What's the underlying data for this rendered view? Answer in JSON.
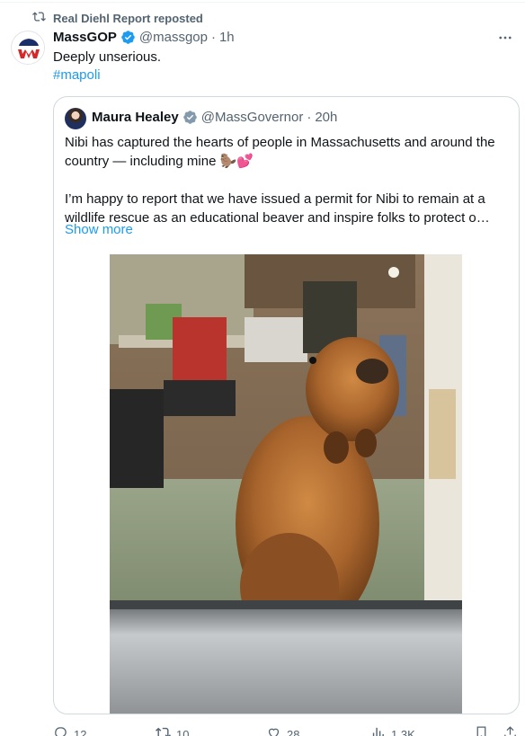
{
  "repost": {
    "label": "Real Diehl Report reposted",
    "icon": "repost-icon"
  },
  "tweet": {
    "author_name": "MassGOP",
    "author_handle": "@massgop",
    "separator": "·",
    "time": "1h",
    "text": "Deeply unserious.",
    "hashtag": "#mapoli",
    "more_icon": "more-horizontal-icon"
  },
  "quote": {
    "author_name": "Maura Healey",
    "author_handle": "@MassGovernor",
    "separator": "·",
    "time": "20h",
    "paragraph1": "Nibi has captured the hearts of people in Massachusetts and around the country — including mine 🦫💕",
    "paragraph2": "I’m happy to report that we have issued a permit for Nibi to remain at a wildlife rescue as an educational beaver and inspire folks to protect o…",
    "show_more": "Show more",
    "photo_alt": "beaver-photo"
  },
  "actions": {
    "replies": "12",
    "reposts": "10",
    "likes": "28",
    "views": "1.3K"
  },
  "colors": {
    "link": "#1d9bf0",
    "secondary": "#536471",
    "verified_gold": "#e2b719",
    "verified_gray": "#829aab",
    "border": "#cfd9de"
  }
}
